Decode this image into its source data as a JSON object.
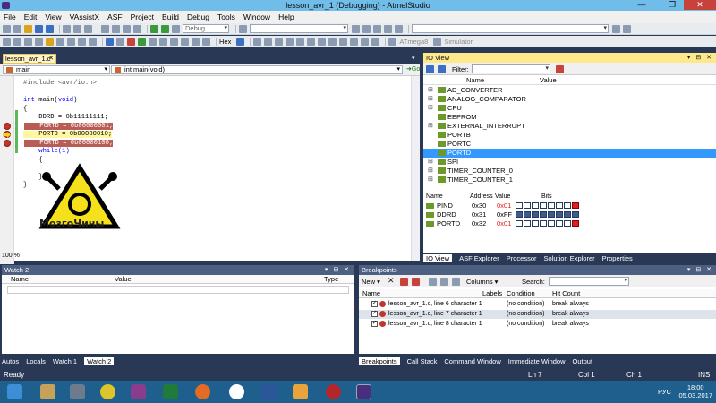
{
  "window": {
    "title": "lesson_avr_1 (Debugging) - AtmelStudio",
    "controls": [
      "—",
      "❐",
      "✕"
    ]
  },
  "menu": [
    "File",
    "Edit",
    "View",
    "VAssistX",
    "ASF",
    "Project",
    "Build",
    "Debug",
    "Tools",
    "Window",
    "Help"
  ],
  "toolbar": {
    "config_value": "Debug",
    "hex_label": "Hex",
    "device_label": "ATmega8",
    "tool_label": "Simulator"
  },
  "editor": {
    "tab_label": "lesson_avr_1.c",
    "scope_combo": "main",
    "func_combo": "int main(void)",
    "go_label": "Go",
    "zoom": "100 %",
    "lines": [
      {
        "text": "#include <avr/io.h>",
        "kind": "pp"
      },
      {
        "text": "",
        "kind": "plain"
      },
      {
        "text": "int main(void)",
        "kind": "decl"
      },
      {
        "text": "{",
        "kind": "plain"
      },
      {
        "text": "    DDRD = 0b11111111;",
        "kind": "plain"
      },
      {
        "text": "    PORTD = 0b00000001;",
        "kind": "bp"
      },
      {
        "text": "    PORTD = 0b00000010;",
        "kind": "current"
      },
      {
        "text": "    PORTD = 0b00000100;",
        "kind": "bp"
      },
      {
        "text": "    while(1)",
        "kind": "kw"
      },
      {
        "text": "    {",
        "kind": "plain"
      },
      {
        "text": "",
        "kind": "plain"
      },
      {
        "text": "    }",
        "kind": "plain"
      },
      {
        "text": "}",
        "kind": "plain"
      }
    ],
    "watermark": "МозгоЧины"
  },
  "ioview": {
    "title": "IO View",
    "filter_label": "Filter:",
    "col_name": "Name",
    "col_value": "Value",
    "tree": [
      {
        "label": "AD_CONVERTER",
        "expandable": true
      },
      {
        "label": "ANALOG_COMPARATOR",
        "expandable": true
      },
      {
        "label": "CPU",
        "expandable": true
      },
      {
        "label": "EEPROM",
        "expandable": false
      },
      {
        "label": "EXTERNAL_INTERRUPT",
        "expandable": true
      },
      {
        "label": "PORTB",
        "expandable": false
      },
      {
        "label": "PORTC",
        "expandable": false
      },
      {
        "label": "PORTD",
        "expandable": false,
        "selected": true
      },
      {
        "label": "SPI",
        "expandable": true
      },
      {
        "label": "TIMER_COUNTER_0",
        "expandable": true
      },
      {
        "label": "TIMER_COUNTER_1",
        "expandable": true
      }
    ],
    "reg_headers": {
      "name": "Name",
      "address": "Address",
      "value": "Value",
      "bits": "Bits"
    },
    "registers": [
      {
        "name": "PIND",
        "address": "0x30",
        "value": "0x01",
        "value_red": true,
        "bits": [
          0,
          0,
          0,
          0,
          0,
          0,
          0,
          1
        ]
      },
      {
        "name": "DDRD",
        "address": "0x31",
        "value": "0xFF",
        "value_red": false,
        "bits": [
          1,
          1,
          1,
          1,
          1,
          1,
          1,
          1
        ]
      },
      {
        "name": "PORTD",
        "address": "0x32",
        "value": "0x01",
        "value_red": true,
        "bits": [
          0,
          0,
          0,
          0,
          0,
          0,
          0,
          1
        ]
      }
    ],
    "tabs": [
      "IO View",
      "ASF Explorer",
      "Processor",
      "Solution Explorer",
      "Properties"
    ]
  },
  "watch": {
    "title": "Watch 2",
    "cols": {
      "name": "Name",
      "value": "Value",
      "type": "Type"
    },
    "tabs": [
      "Autos",
      "Locals",
      "Watch 1",
      "Watch 2"
    ]
  },
  "breakpoints": {
    "title": "Breakpoints",
    "toolbar": {
      "new": "New",
      "columns": "Columns",
      "search": "Search:"
    },
    "cols": {
      "name": "Name",
      "labels": "Labels",
      "condition": "Condition",
      "hit": "Hit Count"
    },
    "rows": [
      {
        "name": "lesson_avr_1.c, line 6 character 1",
        "condition": "(no condition)",
        "hit": "break always"
      },
      {
        "name": "lesson_avr_1.c, line 7 character 1",
        "condition": "(no condition)",
        "hit": "break always"
      },
      {
        "name": "lesson_avr_1.c, line 8 character 1",
        "condition": "(no condition)",
        "hit": "break always"
      }
    ],
    "tabs": [
      "Breakpoints",
      "Call Stack",
      "Command Window",
      "Immediate Window",
      "Output"
    ]
  },
  "status": {
    "left": "Ready",
    "ln": "Ln 7",
    "col": "Col 1",
    "ch": "Ch 1",
    "ins": "INS"
  },
  "taskbar": {
    "lang": "РУС",
    "time": "18:00",
    "date": "05.03.2017"
  }
}
